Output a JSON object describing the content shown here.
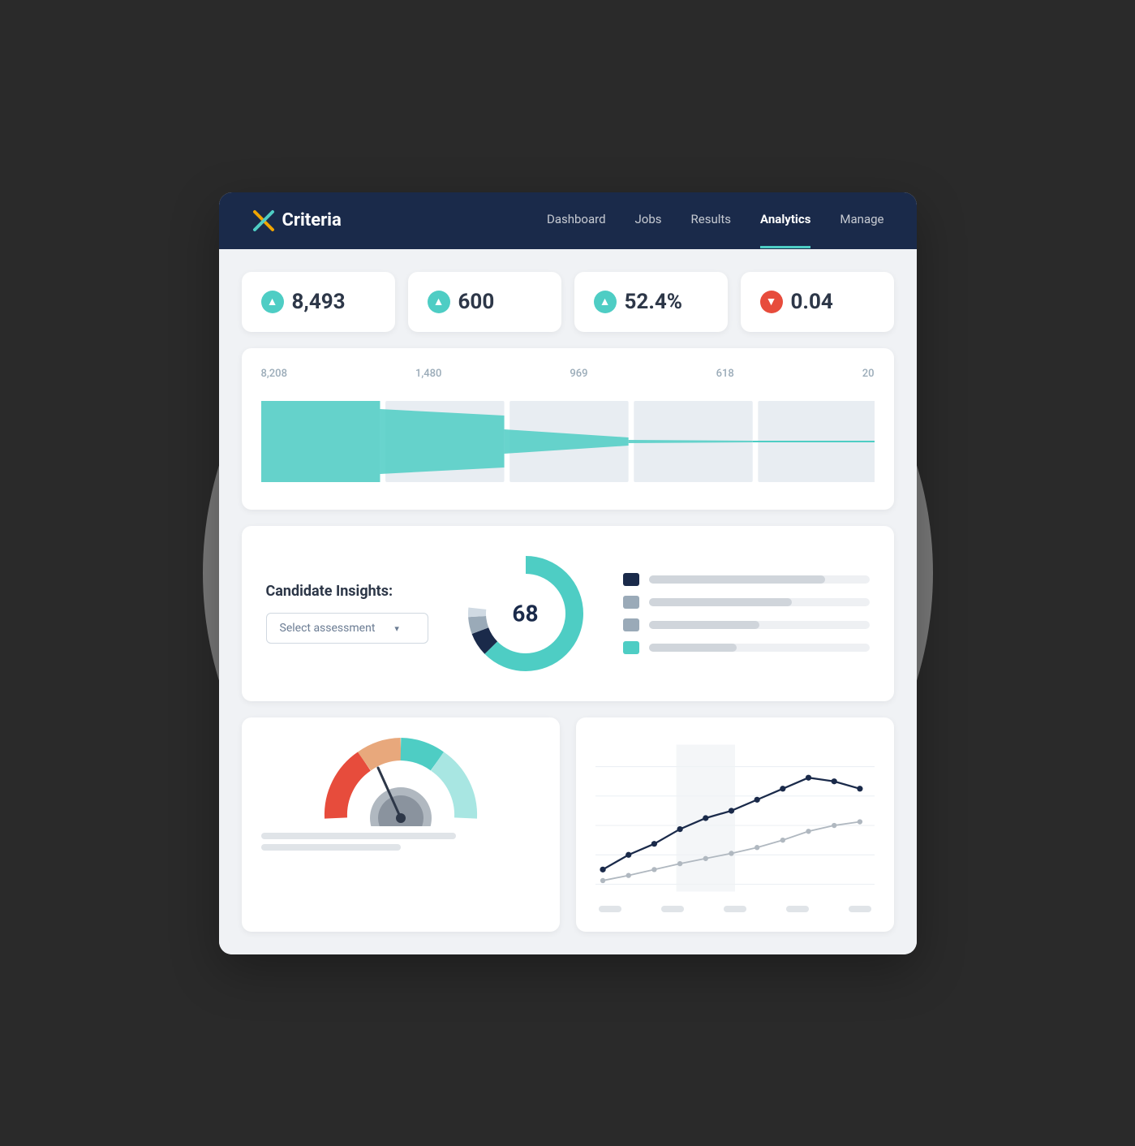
{
  "app": {
    "logo_text": "Criteria",
    "nav": {
      "links": [
        {
          "label": "Dashboard",
          "active": false
        },
        {
          "label": "Jobs",
          "active": false
        },
        {
          "label": "Results",
          "active": false
        },
        {
          "label": "Analytics",
          "active": true
        },
        {
          "label": "Manage",
          "active": false
        }
      ]
    }
  },
  "stat_cards": [
    {
      "value": "8,493",
      "direction": "up"
    },
    {
      "value": "600",
      "direction": "up"
    },
    {
      "value": "52.4%",
      "direction": "up"
    },
    {
      "value": "0.04",
      "direction": "down"
    }
  ],
  "funnel": {
    "labels": [
      "8,208",
      "1,480",
      "969",
      "618",
      "20"
    ]
  },
  "insights": {
    "title": "Candidate Insights:",
    "select_placeholder": "Select assessment",
    "donut_value": "68",
    "legend_items": [
      {
        "color": "#1a2a4a",
        "width": "80"
      },
      {
        "color": "#9aaab8",
        "width": "65"
      },
      {
        "color": "#9aaab8",
        "width": "50"
      },
      {
        "color": "#4ecdc4",
        "width": "40"
      }
    ]
  },
  "icons": {
    "up_arrow": "▲",
    "down_arrow": "▼",
    "chevron_down": "▾"
  }
}
